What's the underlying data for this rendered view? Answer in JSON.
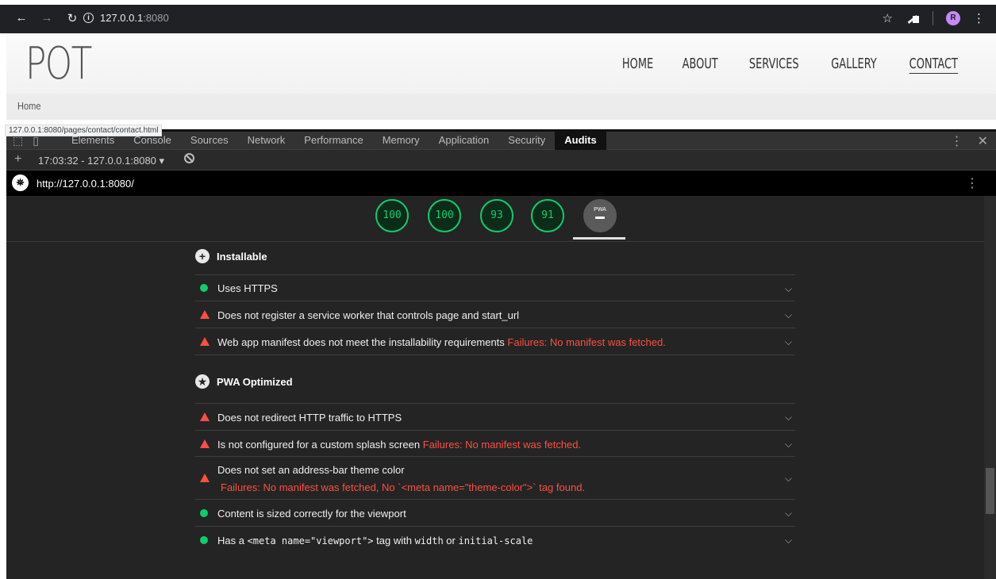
{
  "browser": {
    "url_host": "127.0.0.1",
    "url_port": ":8080",
    "avatar_letter": "R"
  },
  "site": {
    "logo": "POT",
    "nav": [
      "HOME",
      "ABOUT",
      "SERVICES",
      "GALLERY",
      "CONTACT"
    ],
    "active_nav": "CONTACT",
    "breadcrumb": "Home",
    "status_url": "127.0.0.1:8080/pages/contact/contact.html"
  },
  "devtools": {
    "tabs": [
      "Elements",
      "Console",
      "Sources",
      "Network",
      "Performance",
      "Memory",
      "Application",
      "Security",
      "Audits"
    ],
    "active_tab": "Audits",
    "report_select": "17:03:32 - 127.0.0.1:8080 ▾",
    "report_url": "http://127.0.0.1:8080/",
    "scores": [
      "100",
      "100",
      "93",
      "91"
    ],
    "pwa_label": "PWA"
  },
  "groups": {
    "installable": "Installable",
    "pwa_optimized": "PWA Optimized"
  },
  "audits": {
    "a1": {
      "text": "Uses HTTPS"
    },
    "a2": {
      "text": "Does not register a service worker that controls page and start_url"
    },
    "a3": {
      "text": "Web app manifest does not meet the installability requirements",
      "failure": "Failures: No manifest was fetched."
    },
    "a4": {
      "text": "Does not redirect HTTP traffic to HTTPS"
    },
    "a5": {
      "text": "Is not configured for a custom splash screen",
      "failure": "Failures: No manifest was fetched."
    },
    "a6": {
      "text": "Does not set an address-bar theme color",
      "failure": "Failures: No manifest was fetched, No `<meta name=\"theme-color\">` tag found."
    },
    "a7": {
      "text": "Content is sized correctly for the viewport"
    },
    "a8": {
      "pre": "Has a ",
      "code1": "<meta name=\"viewport\">",
      "mid": " tag with ",
      "code2": "width",
      "mid2": " or ",
      "code3": "initial-scale"
    }
  }
}
